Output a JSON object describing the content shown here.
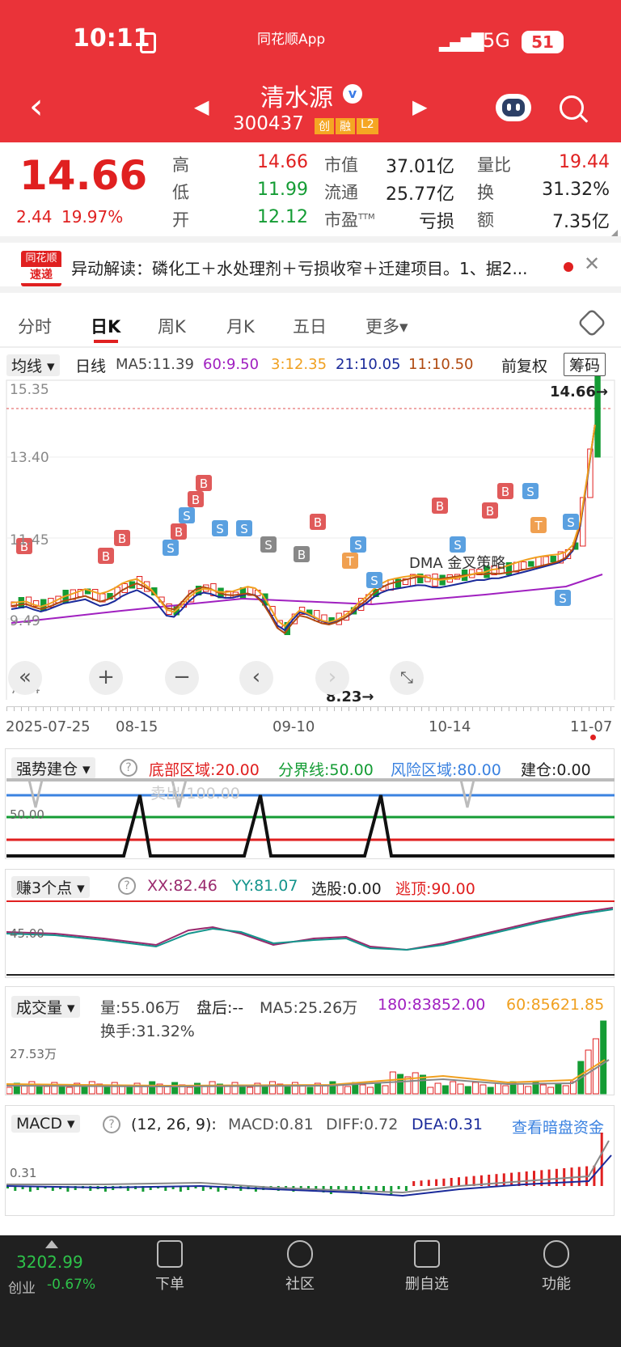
{
  "status": {
    "time": "10:11",
    "app_badge": "同花顺App",
    "network": "5G",
    "battery": "51"
  },
  "header": {
    "title": "清水源",
    "code": "300437",
    "tags": [
      "创",
      "融",
      "L2"
    ]
  },
  "quote": {
    "price": "14.66",
    "change": "2.44",
    "change_pct": "19.97%",
    "stats": [
      {
        "k": "高",
        "v": "14.66",
        "c": "red"
      },
      {
        "k": "市值",
        "v": "37.01亿",
        "c": "dark"
      },
      {
        "k": "量比",
        "v": "19.44",
        "c": "red"
      },
      {
        "k": "低",
        "v": "11.99",
        "c": "green"
      },
      {
        "k": "流通",
        "v": "25.77亿",
        "c": "dark"
      },
      {
        "k": "换",
        "v": "31.32%",
        "c": "dark"
      },
      {
        "k": "开",
        "v": "12.12",
        "c": "green"
      },
      {
        "k": "市盈",
        "sup": "TTM",
        "v": "亏损",
        "c": "dark"
      },
      {
        "k": "额",
        "v": "7.35亿",
        "c": "dark"
      }
    ]
  },
  "news": {
    "brand_top": "同花顺",
    "brand_bottom": "速递",
    "text": "异动解读：磷化工＋水处理剂＋亏损收窄＋迁建项目。1、据2..."
  },
  "tabs": [
    "分时",
    "日K",
    "周K",
    "月K",
    "五日",
    "更多▾"
  ],
  "kline": {
    "ma_type": "均线",
    "period": "日线",
    "ma5": "MA5:11.39",
    "ma60": "60:9.50",
    "ma3": "3:12.35",
    "ma21": "21:10.05",
    "ma11": "11:10.50",
    "adjust": "前复权",
    "chip_button": "筹码",
    "y_labels": [
      "15.35",
      "13.40",
      "11.45",
      "9.49",
      "7.54"
    ],
    "max_label": "14.66→",
    "min_label": "8.23→",
    "strategy": "DMA 金叉策略",
    "dates": [
      "2025-07-25",
      "08-15",
      "09-10",
      "10-14",
      "11-07"
    ]
  },
  "ind1": {
    "name": "强势建仓",
    "bottom": "底部区域:20.00",
    "mid": "分界线:50.00",
    "risk": "风险区域:80.00",
    "build": "建仓:0.00",
    "sell": "卖出:100.00",
    "level": "50.00"
  },
  "ind2": {
    "name": "赚3个点",
    "xx": "XX:82.46",
    "yy": "YY:81.07",
    "pick": "选股:0.00",
    "escape": "逃顶:90.00",
    "level": "45.00"
  },
  "vol": {
    "name": "成交量",
    "vol": "量:55.06万",
    "after": "盘后:--",
    "ma5": "MA5:25.26万",
    "ma180": "180:83852.00",
    "ma60": "60:85621.85",
    "turnover": "换手:31.32%",
    "level": "27.53万"
  },
  "macd": {
    "name": "MACD",
    "params": "(12, 26, 9):",
    "macd": "MACD:0.81",
    "diff": "DIFF:0.72",
    "dea": "DEA:0.31",
    "link": "查看暗盘资金",
    "level": "0.31"
  },
  "bottom": {
    "index_value": "3202.99",
    "index_name": "创业",
    "index_change": "-0.67%",
    "nav": [
      "下单",
      "社区",
      "删自选",
      "功能"
    ]
  }
}
